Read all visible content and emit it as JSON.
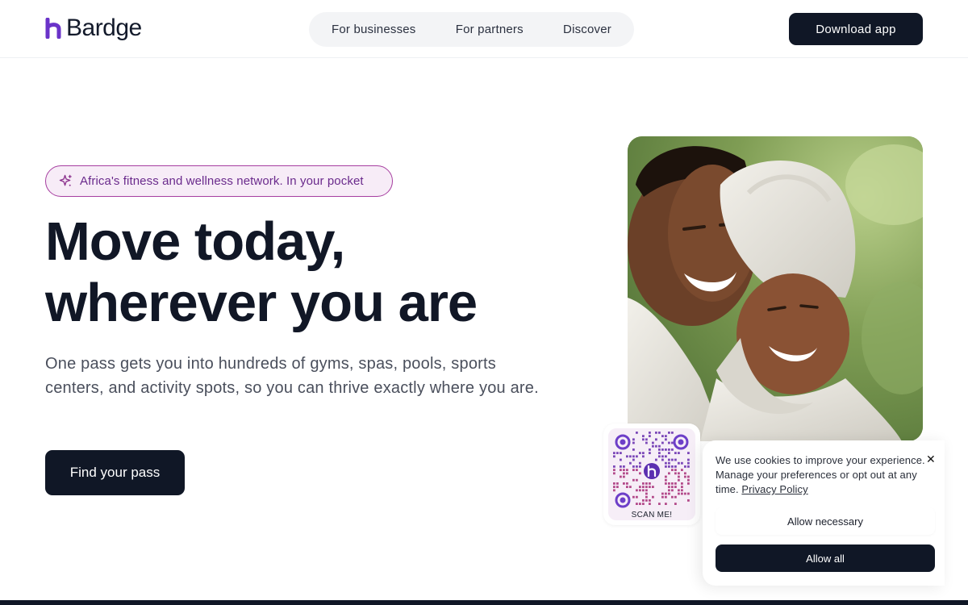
{
  "brand": {
    "name": "Bardge",
    "accent": "#6a33c9"
  },
  "nav": {
    "links": [
      "For businesses",
      "For partners",
      "Discover"
    ],
    "download_label": "Download app"
  },
  "hero": {
    "badge_icon": "sparkle-icon",
    "badge_text": "Africa's fitness and wellness network. In your pocket",
    "headline_line1": "Move today,",
    "headline_line2": "wherever you are",
    "subtext": "One pass gets you into hundreds of gyms, spas, pools, sports centers, and activity spots, so you can thrive exactly where you are.",
    "cta_label": "Find your pass"
  },
  "qr": {
    "label": "SCAN ME!"
  },
  "cookie": {
    "message": "We use cookies to improve your experience. Manage your preferences or opt out at any time.",
    "privacy_link": "Privacy Policy",
    "close_icon": "close-icon",
    "allow_necessary_label": "Allow necessary",
    "allow_all_label": "Allow all"
  },
  "colors": {
    "dark": "#101726",
    "badge_border": "#a63ea0",
    "badge_bg": "#f7ecf7",
    "badge_text": "#6a2a8c"
  }
}
